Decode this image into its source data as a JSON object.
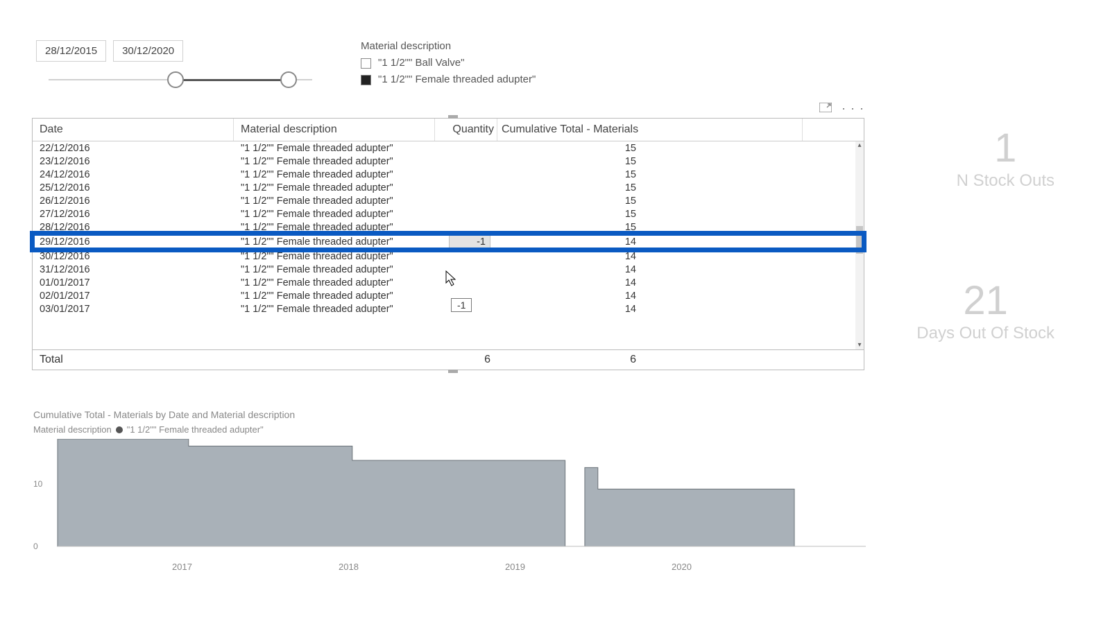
{
  "date_slicer": {
    "from": "28/12/2015",
    "to": "30/12/2020"
  },
  "material_filter": {
    "title": "Material description",
    "options": [
      {
        "label": "\"1 1/2\"\" Ball Valve\"",
        "checked": false
      },
      {
        "label": "\"1 1/2\"\" Female threaded adupter\"",
        "checked": true
      }
    ]
  },
  "table": {
    "headers": {
      "date": "Date",
      "desc": "Material description",
      "qty": "Quantity",
      "cum": "Cumulative Total - Materials"
    },
    "rows": [
      {
        "date": "22/12/2016",
        "desc": "\"1 1/2\"\" Female threaded adupter\"",
        "qty": "",
        "cum": "15"
      },
      {
        "date": "23/12/2016",
        "desc": "\"1 1/2\"\" Female threaded adupter\"",
        "qty": "",
        "cum": "15"
      },
      {
        "date": "24/12/2016",
        "desc": "\"1 1/2\"\" Female threaded adupter\"",
        "qty": "",
        "cum": "15"
      },
      {
        "date": "25/12/2016",
        "desc": "\"1 1/2\"\" Female threaded adupter\"",
        "qty": "",
        "cum": "15"
      },
      {
        "date": "26/12/2016",
        "desc": "\"1 1/2\"\" Female threaded adupter\"",
        "qty": "",
        "cum": "15"
      },
      {
        "date": "27/12/2016",
        "desc": "\"1 1/2\"\" Female threaded adupter\"",
        "qty": "",
        "cum": "15"
      },
      {
        "date": "28/12/2016",
        "desc": "\"1 1/2\"\" Female threaded adupter\"",
        "qty": "",
        "cum": "15"
      },
      {
        "date": "29/12/2016",
        "desc": "\"1 1/2\"\" Female threaded adupter\"",
        "qty": "-1",
        "cum": "14",
        "highlight": true
      },
      {
        "date": "30/12/2016",
        "desc": "\"1 1/2\"\" Female threaded adupter\"",
        "qty": "",
        "cum": "14"
      },
      {
        "date": "31/12/2016",
        "desc": "\"1 1/2\"\" Female threaded adupter\"",
        "qty": "",
        "cum": "14"
      },
      {
        "date": "01/01/2017",
        "desc": "\"1 1/2\"\" Female threaded adupter\"",
        "qty": "",
        "cum": "14"
      },
      {
        "date": "02/01/2017",
        "desc": "\"1 1/2\"\" Female threaded adupter\"",
        "qty": "",
        "cum": "14"
      },
      {
        "date": "03/01/2017",
        "desc": "\"1 1/2\"\" Female threaded adupter\"",
        "qty": "",
        "cum": "14"
      }
    ],
    "footer": {
      "label": "Total",
      "qty": "6",
      "cum": "6"
    }
  },
  "tooltip": "-1",
  "kpis": {
    "stock_outs": {
      "value": "1",
      "label": "N Stock Outs"
    },
    "days_out": {
      "value": "21",
      "label": "Days Out Of Stock"
    }
  },
  "chart_data": {
    "type": "area",
    "title": "Cumulative Total - Materials by Date and Material description",
    "legend_title": "Material description",
    "series": [
      {
        "name": "\"1 1/2\"\" Female threaded adupter\"",
        "x": [
          "2016.0",
          "2016.8",
          "2016.8",
          "2017.8",
          "2017.8",
          "2019.1",
          "2019.1",
          "2019.22",
          "2019.22",
          "2019.3",
          "2019.3",
          "2020.5"
        ],
        "y": [
          15,
          15,
          14,
          14,
          12,
          12,
          0,
          0,
          11,
          11,
          8,
          8
        ]
      }
    ],
    "xlabel": "",
    "ylabel": "",
    "x_ticks": [
      "2017",
      "2018",
      "2019",
      "2020"
    ],
    "y_ticks": [
      "0",
      "10"
    ],
    "ylim": [
      0,
      15
    ]
  }
}
